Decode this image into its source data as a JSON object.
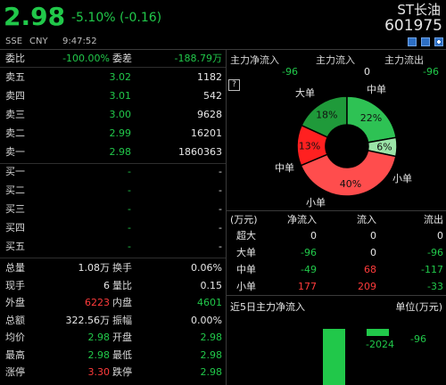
{
  "header": {
    "price": "2.98",
    "change": "-5.10% (-0.16)",
    "name": "ST长油",
    "code": "601975",
    "exchange": "SSE",
    "currency": "CNY",
    "time": "9:47:52",
    "icons": [
      "edit-icon",
      "document-icon",
      "add-icon"
    ]
  },
  "orderbook": {
    "ratio_label": "委比",
    "ratio_value": "-100.00%",
    "diff_label": "委差",
    "diff_value": "-188.79万",
    "asks": [
      {
        "label": "卖五",
        "price": "3.02",
        "volume": "1182"
      },
      {
        "label": "卖四",
        "price": "3.01",
        "volume": "542"
      },
      {
        "label": "卖三",
        "price": "3.00",
        "volume": "9628"
      },
      {
        "label": "卖二",
        "price": "2.99",
        "volume": "16201"
      },
      {
        "label": "卖一",
        "price": "2.98",
        "volume": "1860363"
      }
    ],
    "bids": [
      {
        "label": "买一",
        "price": "-",
        "volume": "-"
      },
      {
        "label": "买二",
        "price": "-",
        "volume": "-"
      },
      {
        "label": "买三",
        "price": "-",
        "volume": "-"
      },
      {
        "label": "买四",
        "price": "-",
        "volume": "-"
      },
      {
        "label": "买五",
        "price": "-",
        "volume": "-"
      }
    ]
  },
  "stats": [
    {
      "l1": "总量",
      "v1": "1.08万",
      "l2": "换手",
      "v2": "0.06%"
    },
    {
      "l1": "现手",
      "v1": "6",
      "l2": "量比",
      "v2": "0.15"
    },
    {
      "l1": "外盘",
      "v1": "6223",
      "l2": "内盘",
      "v2": "4601"
    },
    {
      "l1": "总额",
      "v1": "322.56万",
      "l2": "振幅",
      "v2": "0.00%"
    },
    {
      "l1": "均价",
      "v1": "2.98",
      "l2": "开盘",
      "v2": "2.98"
    },
    {
      "l1": "最高",
      "v1": "2.98",
      "l2": "最低",
      "v2": "2.98"
    },
    {
      "l1": "涨停",
      "v1": "3.30",
      "l2": "跌停",
      "v2": "2.98"
    }
  ],
  "mainflow": {
    "inflow_label": "主力净流入",
    "inflow_value": "-96",
    "in_label": "主力流入",
    "in_value": "0",
    "out_label": "主力流出",
    "out_value": "-96",
    "help_icon": "?"
  },
  "donut": {
    "segments": [
      {
        "name": "大单",
        "pct": 18,
        "label": "18%",
        "color": "#1f9a3a"
      },
      {
        "name": "中单",
        "pct": 22,
        "label": "22%",
        "color": "#2ec254"
      },
      {
        "name": "小单",
        "pct": 6,
        "label": "6%",
        "color": "#9be5a8"
      },
      {
        "name": "小单",
        "pct": 40,
        "label": "40%",
        "color": "#ff4d4d"
      },
      {
        "name": "中单",
        "pct": 13,
        "label": "13%",
        "color": "#ff2020"
      }
    ],
    "labels": {
      "big_left": "大单",
      "mid_left": "中单",
      "small_left": "小单",
      "mid_right": "中单",
      "small_right": "小单"
    }
  },
  "flow_table": {
    "headers": [
      "(万元)",
      "净流入",
      "流入",
      "流出"
    ],
    "rows": [
      {
        "name": "超大",
        "net": "0",
        "in": "0",
        "out": "0"
      },
      {
        "name": "大单",
        "net": "-96",
        "in": "0",
        "out": "-96"
      },
      {
        "name": "中单",
        "net": "-49",
        "in": "68",
        "out": "-117"
      },
      {
        "name": "小单",
        "net": "177",
        "in": "209",
        "out": "-33"
      }
    ]
  },
  "five_day": {
    "title": "近5日主力净流入",
    "unit": "单位(万元)",
    "bar_values": [
      "-2024",
      "-96"
    ]
  }
}
